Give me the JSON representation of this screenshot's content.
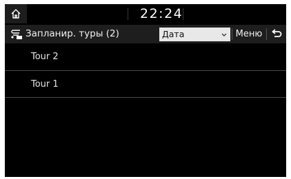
{
  "status_bar": {
    "time": "22:24",
    "home_icon": "home-icon"
  },
  "header": {
    "route_icon": "route-icon",
    "title": "Запланир. туры (2)",
    "sort": {
      "selected": "Дата",
      "icon": "chevron-down-icon"
    },
    "menu_label": "Меню",
    "back_icon": "back-arrow-icon"
  },
  "tours": [
    {
      "label": "Tour 2"
    },
    {
      "label": "Tour 1"
    }
  ],
  "colors": {
    "background": "#000000",
    "header_bg": "#1e1e1e",
    "select_bg": "#e8e8e8",
    "text": "#e6e6e6",
    "divider": "#4a4a4a"
  }
}
